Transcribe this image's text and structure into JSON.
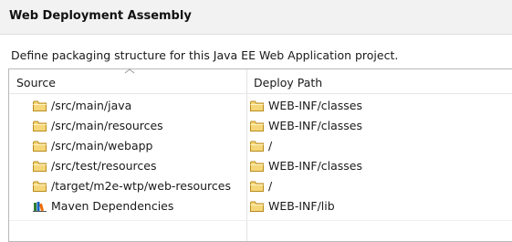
{
  "title": "Web Deployment Assembly",
  "description": "Define packaging structure for this Java EE Web Application project.",
  "table": {
    "columns": {
      "source": "Source",
      "deploy": "Deploy Path"
    },
    "rows": [
      {
        "source": "/src/main/java",
        "source_icon": "folder-icon",
        "deploy": "WEB-INF/classes",
        "deploy_icon": "folder-icon"
      },
      {
        "source": "/src/main/resources",
        "source_icon": "folder-icon",
        "deploy": "WEB-INF/classes",
        "deploy_icon": "folder-icon"
      },
      {
        "source": "/src/main/webapp",
        "source_icon": "folder-icon",
        "deploy": "/",
        "deploy_icon": "folder-icon"
      },
      {
        "source": "/src/test/resources",
        "source_icon": "folder-icon",
        "deploy": "WEB-INF/classes",
        "deploy_icon": "folder-icon"
      },
      {
        "source": "/target/m2e-wtp/web-resources",
        "source_icon": "folder-icon",
        "deploy": "/",
        "deploy_icon": "folder-icon"
      },
      {
        "source": "Maven Dependencies",
        "source_icon": "library-icon",
        "deploy": "WEB-INF/lib",
        "deploy_icon": "folder-icon"
      }
    ]
  },
  "colors": {
    "folder_fill": "#f5d77a",
    "folder_stroke": "#b98b1c"
  }
}
